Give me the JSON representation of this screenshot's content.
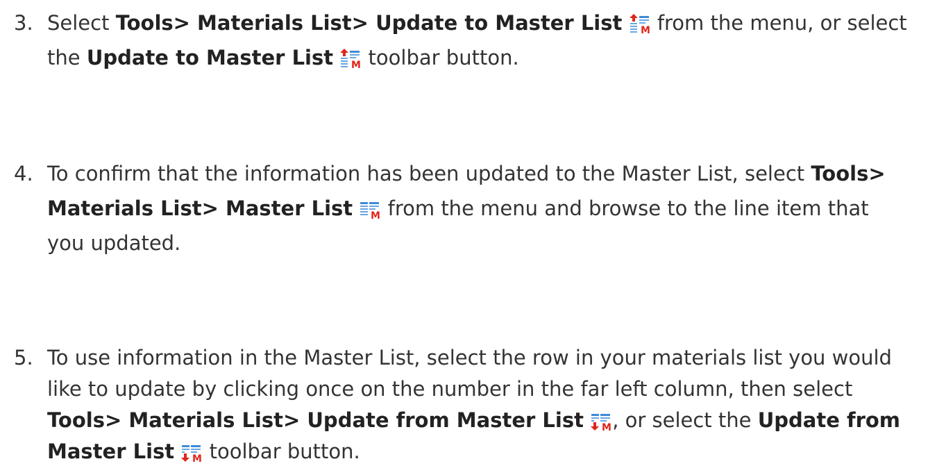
{
  "steps": [
    {
      "number": "3.",
      "line1": {
        "t1": "Select ",
        "b1": "Tools> Materials List> Update to Master List",
        "t2": " from the menu, or select"
      },
      "line2": {
        "t1": "the ",
        "b1": "Update to Master List",
        "t2": " toolbar button."
      }
    },
    {
      "number": "4.",
      "line1": {
        "t1": "To confirm that the information has been updated to the Master List, select ",
        "b1": "Tools>"
      },
      "line2": {
        "b1": "Materials List> Master List",
        "t2": " from the menu and browse to the line item that"
      },
      "line3": {
        "t1": "you updated."
      }
    },
    {
      "number": "5.",
      "line1": {
        "t1": "To use information in the Master List, select the row in your materials list you would"
      },
      "line2": {
        "t1": "like to update by clicking once on the number in the far left column, then select"
      },
      "line3": {
        "b1": "Tools> Materials List> Update from Master List",
        "t2": ", or select the ",
        "b2": "Update from"
      },
      "line4": {
        "b1": "Master List",
        "t2": " toolbar button."
      }
    }
  ],
  "icons": {
    "update_to_master": "update-to-master-list-icon",
    "master_list": "master-list-icon",
    "update_from_master": "update-from-master-list-icon",
    "accent_red": "#e0261b",
    "accent_blue": "#2f7fd0",
    "letter": "M"
  }
}
